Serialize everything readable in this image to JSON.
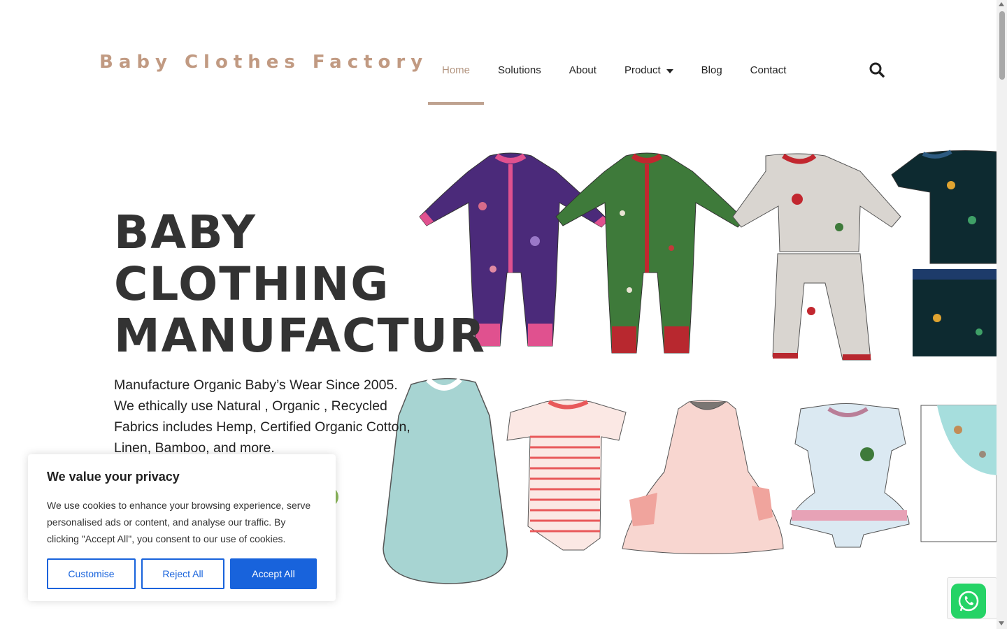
{
  "header": {
    "logo_text": "Baby Clothes Factory",
    "nav": [
      {
        "label": "Home",
        "active": true
      },
      {
        "label": "Solutions"
      },
      {
        "label": "About"
      },
      {
        "label": "Product",
        "has_dropdown": true
      },
      {
        "label": "Blog"
      },
      {
        "label": "Contact"
      }
    ],
    "search_icon": "search-icon"
  },
  "hero": {
    "title_lines": [
      "BABY",
      "CLOTHING",
      "MANUFACTUR"
    ],
    "description": "Manufacture Organic Baby’s Wear Since 2005. We ethically use Natural , Organic , Recycled Fabrics includes Hemp, Certified Organic Cotton, Linen, Bamboo, and more."
  },
  "cookie": {
    "title": "We value your privacy",
    "text": "We use cookies to enhance your browsing experience, serve personalised ads or content, and analyse our traffic. By clicking \"Accept All\", you consent to our use of cookies.",
    "customise_label": "Customise",
    "reject_label": "Reject All",
    "accept_label": "Accept All"
  },
  "colors": {
    "brand": "#c19a82",
    "accent_blue": "#1863dc",
    "whatsapp": "#25d366"
  }
}
